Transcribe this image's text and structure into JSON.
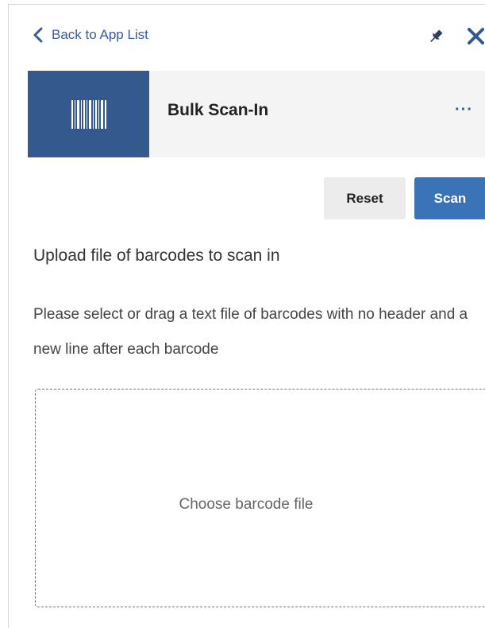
{
  "nav": {
    "back_label": "Back to App List"
  },
  "app": {
    "title": "Bulk Scan-In",
    "more_label": "···"
  },
  "actions": {
    "reset_label": "Reset",
    "scan_label": "Scan"
  },
  "upload": {
    "heading": "Upload file of barcodes to scan in",
    "instructions": "Please select or drag a text file of barcodes with no header and a new line after each barcode",
    "dropzone_label": "Choose barcode file"
  },
  "icons": {
    "back": "chevron-left-icon",
    "pin": "pin-icon",
    "close": "close-icon",
    "app": "barcode-icon"
  },
  "colors": {
    "accent": "#3a73b8",
    "link": "#3a5a9b",
    "app_icon_bg": "#34598c",
    "header_bg": "#f4f4f4"
  }
}
